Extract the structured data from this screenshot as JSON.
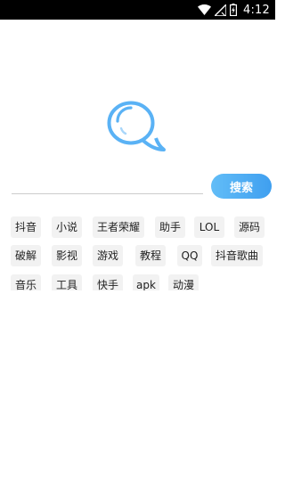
{
  "status_bar": {
    "time": "4:12",
    "icons": [
      "wifi-icon",
      "no-signal-icon",
      "battery-charging-icon"
    ]
  },
  "search": {
    "value": "",
    "placeholder": "",
    "button_label": "搜索"
  },
  "colors": {
    "accent": "#4aa9f3",
    "tag_bg": "#f2f2f2",
    "logo": "#5ab2f5"
  },
  "tags": [
    "抖音",
    "小说",
    "王者荣耀",
    "助手",
    "LOL",
    "源码",
    "破解",
    "影视",
    "游戏",
    "教程",
    "QQ",
    "抖音歌曲",
    "音乐",
    "工具",
    "快手",
    "apk",
    "动漫"
  ]
}
